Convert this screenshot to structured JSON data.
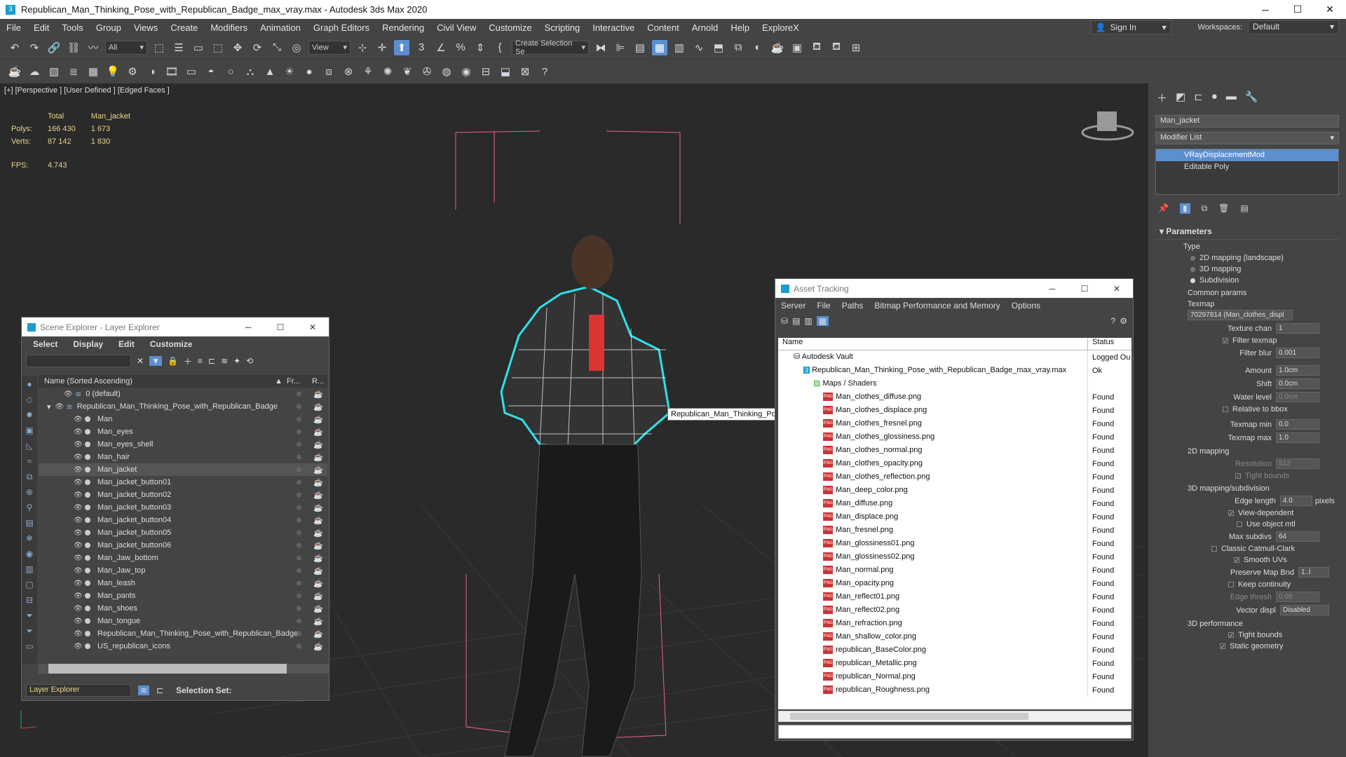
{
  "window": {
    "title": "Republican_Man_Thinking_Pose_with_Republican_Badge_max_vray.max - Autodesk 3ds Max 2020",
    "app_icon": "3"
  },
  "menu": [
    "File",
    "Edit",
    "Tools",
    "Group",
    "Views",
    "Create",
    "Modifiers",
    "Animation",
    "Graph Editors",
    "Rendering",
    "Civil View",
    "Customize",
    "Scripting",
    "Interactive",
    "Content",
    "Arnold",
    "Help",
    "ExploreX"
  ],
  "account": {
    "sign_in": "Sign In",
    "workspaces_label": "Workspaces:",
    "workspace": "Default"
  },
  "toolbar": {
    "filter": "All",
    "ref_coord": "View",
    "selection_set": "Create Selection Se"
  },
  "viewport": {
    "label": "[+] [Perspective ] [User Defined ] [Edged Faces ]",
    "stats": {
      "h_total": "Total",
      "h_obj": "Man_jacket",
      "polys_label": "Polys:",
      "polys_total": "166 430",
      "polys_obj": "1 673",
      "verts_label": "Verts:",
      "verts_total": "87 142",
      "verts_obj": "1 830",
      "fps_label": "FPS:",
      "fps": "4.743"
    },
    "tooltip": "Republican_Man_Thinking_Pose_with_Republican_Badge"
  },
  "command_panel": {
    "object_name": "Man_jacket",
    "modifier_list": "Modifier List",
    "stack": [
      "VRayDisplacementMod",
      "Editable Poly"
    ],
    "rollout": "Parameters",
    "type_label": "Type",
    "types": [
      "2D mapping (landscape)",
      "3D mapping",
      "Subdivision"
    ],
    "common_label": "Common params",
    "texmap_label": "Texmap",
    "texmap": "70297814 (Man_clothes_displ",
    "texture_chan_label": "Texture chan",
    "texture_chan": "1",
    "filter_texmap": "Filter texmap",
    "filter_blur_label": "Filter blur",
    "filter_blur": "0.001",
    "amount_label": "Amount",
    "amount": "1.0cm",
    "shift_label": "Shift",
    "shift": "0.0cm",
    "water_label": "Water level",
    "water": "0.0cm",
    "relative_bbox": "Relative to bbox",
    "texmap_min_label": "Texmap min",
    "texmap_min": "0.0",
    "texmap_max_label": "Texmap max",
    "texmap_max": "1.0",
    "map2d_label": "2D mapping",
    "resolution_label": "Resolution",
    "resolution": "512",
    "tight_bounds": "Tight bounds",
    "map3d_label": "3D mapping/subdivision",
    "edge_len_label": "Edge length",
    "edge_len": "4.0",
    "pixels": "pixels",
    "view_dependent": "View-dependent",
    "use_obj_mtl": "Use object mtl",
    "max_subdivs_label": "Max subdivs",
    "max_subdivs": "64",
    "classic_catmull": "Classic Catmull-Clark",
    "smooth_uvs": "Smooth UVs",
    "preserve_label": "Preserve Map Bnd",
    "preserve": "1..l",
    "keep_continuity": "Keep continuity",
    "edge_thresh_label": "Edge thresh",
    "edge_thresh": "0.05",
    "vector_label": "Vector displ",
    "vector": "Disabled",
    "perf_label": "3D performance",
    "tight_bounds2": "Tight bounds",
    "static_geo": "Static geometry"
  },
  "scene_explorer": {
    "title": "Scene Explorer - Layer Explorer",
    "menu": [
      "Select",
      "Display",
      "Edit",
      "Customize"
    ],
    "col_name": "Name (Sorted Ascending)",
    "col_fr": "Fr...",
    "col_r": "R...",
    "rows": [
      {
        "name": "0 (default)",
        "indent": 0
      },
      {
        "name": "Republican_Man_Thinking_Pose_with_Republican_Badge",
        "indent": 0
      },
      {
        "name": "Man",
        "indent": 1
      },
      {
        "name": "Man_eyes",
        "indent": 1
      },
      {
        "name": "Man_eyes_shell",
        "indent": 1
      },
      {
        "name": "Man_hair",
        "indent": 1
      },
      {
        "name": "Man_jacket",
        "indent": 1
      },
      {
        "name": "Man_jacket_button01",
        "indent": 1
      },
      {
        "name": "Man_jacket_button02",
        "indent": 1
      },
      {
        "name": "Man_jacket_button03",
        "indent": 1
      },
      {
        "name": "Man_jacket_button04",
        "indent": 1
      },
      {
        "name": "Man_jacket_button05",
        "indent": 1
      },
      {
        "name": "Man_jacket_button06",
        "indent": 1
      },
      {
        "name": "Man_Jaw_bottom",
        "indent": 1
      },
      {
        "name": "Man_Jaw_top",
        "indent": 1
      },
      {
        "name": "Man_leash",
        "indent": 1
      },
      {
        "name": "Man_pants",
        "indent": 1
      },
      {
        "name": "Man_shoes",
        "indent": 1
      },
      {
        "name": "Man_tongue",
        "indent": 1
      },
      {
        "name": "Republican_Man_Thinking_Pose_with_Republican_Badge",
        "indent": 1
      },
      {
        "name": "US_republican_icons",
        "indent": 1
      }
    ],
    "layer_explorer": "Layer Explorer",
    "selection_set": "Selection Set:"
  },
  "asset_tracking": {
    "title": "Asset Tracking",
    "menu": [
      "Server",
      "File",
      "Paths",
      "Bitmap Performance and Memory",
      "Options"
    ],
    "col_name": "Name",
    "col_status": "Status",
    "vault": "Autodesk Vault",
    "vault_status": "Logged Ou",
    "file": "Republican_Man_Thinking_Pose_with_Republican_Badge_max_vray.max",
    "file_status": "Ok",
    "maps_label": "Maps / Shaders",
    "maps": [
      "Man_clothes_diffuse.png",
      "Man_clothes_displace.png",
      "Man_clothes_fresnel.png",
      "Man_clothes_glossiness.png",
      "Man_clothes_normal.png",
      "Man_clothes_opacity.png",
      "Man_clothes_reflection.png",
      "Man_deep_color.png",
      "Man_diffuse.png",
      "Man_displace.png",
      "Man_fresnel.png",
      "Man_glossiness01.png",
      "Man_glossiness02.png",
      "Man_normal.png",
      "Man_opacity.png",
      "Man_reflect01.png",
      "Man_reflect02.png",
      "Man_refraction.png",
      "Man_shallow_color.png",
      "republican_BaseColor.png",
      "republican_Metallic.png",
      "republican_Normal.png",
      "republican_Roughness.png"
    ],
    "found": "Found",
    "png_badge": "PNG"
  }
}
